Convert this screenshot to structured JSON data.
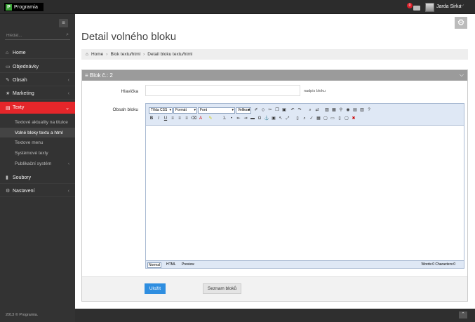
{
  "app": {
    "logo_text": "Programia",
    "logo_mark": "P"
  },
  "topbar": {
    "notification_count": "0",
    "user_name": "Jarda Sirka",
    "user_caret": "⌵"
  },
  "sidebar": {
    "menu_toggle": "≡",
    "search_placeholder": "Hledat...",
    "items": [
      {
        "label": "Home",
        "icon": "home-icon",
        "glyph": "⌂"
      },
      {
        "label": "Objednávky",
        "icon": "orders-icon",
        "glyph": "▭"
      },
      {
        "label": "Obsah",
        "icon": "pencil-icon",
        "glyph": "✎",
        "chevron": "‹"
      },
      {
        "label": "Marketing",
        "icon": "star-icon",
        "glyph": "★",
        "chevron": "‹"
      },
      {
        "label": "Texty",
        "icon": "document-icon",
        "glyph": "▤",
        "chevron": "⌄"
      },
      {
        "label": "Soubory",
        "icon": "file-icon",
        "glyph": "▮"
      },
      {
        "label": "Nastavení",
        "icon": "settings-icon",
        "glyph": "⚙",
        "chevron": "‹"
      }
    ],
    "subitems": [
      {
        "label": "Textové aktuality na titulce"
      },
      {
        "label": "Volné bloky textu a html"
      },
      {
        "label": "Textove menu"
      },
      {
        "label": "Systémové texty"
      },
      {
        "label": "Publikační systém",
        "chevron": "‹"
      }
    ],
    "copyright": "2013 © Programia."
  },
  "main": {
    "title": "Detail volného bloku",
    "breadcrumb": [
      "Home",
      "Blok textu/html",
      "Detail bloku textu/html"
    ],
    "panel_title": "≡ Blok č.: 2",
    "fields": {
      "heading_label": "Hlavička",
      "heading_value": "",
      "heading_hint": "nadpis bloku",
      "content_label": "Obsah bloku"
    },
    "editor": {
      "selects": [
        "Třída CSS",
        "Formát",
        "Font",
        "Velikost"
      ],
      "modes": [
        "Normal",
        "HTML",
        "Preview"
      ],
      "wordcount": "Words:0 Characters:0"
    },
    "buttons": {
      "save": "Uložit",
      "list": "Seznam bloků"
    }
  },
  "colors": {
    "accent": "#e5262a",
    "primary_button": "#2f8ee0",
    "sidebar": "#333333"
  }
}
